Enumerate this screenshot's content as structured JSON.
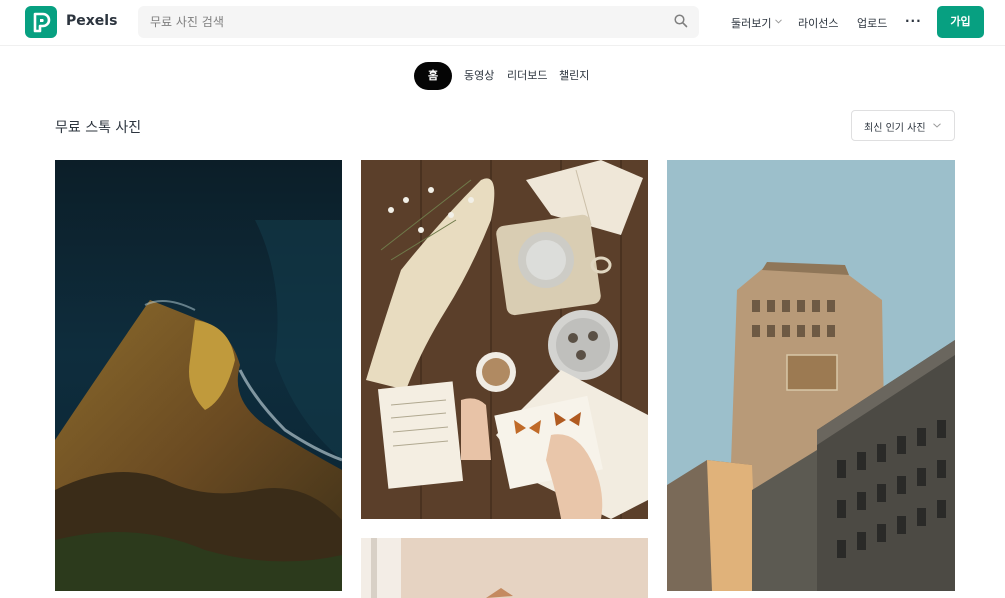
{
  "header": {
    "brand": "Pexels",
    "search_placeholder": "무료 사진 검색",
    "nav": {
      "browse": "둘러보기",
      "license": "라이선스",
      "upload": "업로드",
      "more": "···"
    },
    "join_label": "가입"
  },
  "tabs": {
    "home": "홈",
    "videos": "동영상",
    "leaderboard": "리더보드",
    "challenges": "챌린지"
  },
  "section": {
    "title": "무료 스톡 사진",
    "sort_label": "최신 인기 사진"
  },
  "colors": {
    "brand_green": "#07a081",
    "tab_active_bg": "#050505"
  },
  "photos": [
    {
      "id": "aerial-coast",
      "subject": "aerial coastline"
    },
    {
      "id": "table-flatlay",
      "subject": "tea and book flatlay"
    },
    {
      "id": "building",
      "subject": "historic building"
    },
    {
      "id": "partial",
      "subject": "interior"
    }
  ]
}
